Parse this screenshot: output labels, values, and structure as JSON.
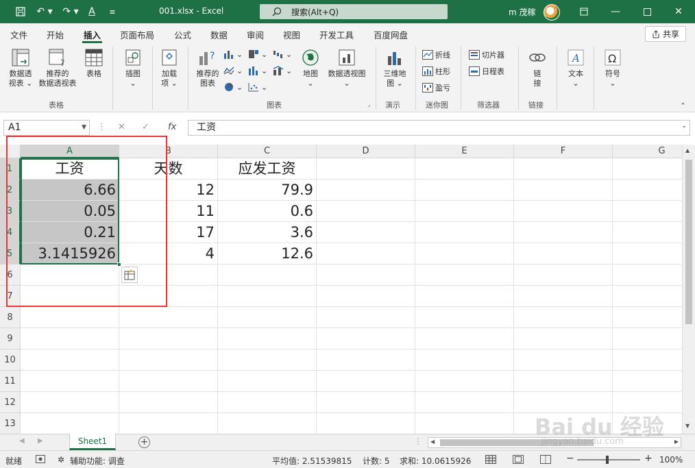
{
  "window": {
    "doc_title": "001.xlsx  -  Excel",
    "search_placeholder": "搜索(Alt+Q)",
    "user": "m 茂稼",
    "accent": "#1e7145"
  },
  "menu": {
    "tabs": [
      "文件",
      "开始",
      "插入",
      "页面布局",
      "公式",
      "数据",
      "审阅",
      "视图",
      "开发工具",
      "百度网盘"
    ],
    "active": "插入",
    "share": "共享"
  },
  "ribbon": {
    "pivot1": "数据透",
    "pivot2": "视表",
    "recpivot1": "推荐的",
    "recpivot2": "数据透视表",
    "table": "表格",
    "group_table": "表格",
    "illustration": "插图",
    "addin1": "加载",
    "addin2": "项",
    "recchart1": "推荐的",
    "recchart2": "图表",
    "map": "地图",
    "pivotchart": "数据透视图",
    "group_chart": "图表",
    "map3d1": "三维地",
    "map3d2": "图",
    "group_tour": "演示",
    "spark_line": "折线",
    "spark_column": "柱形",
    "spark_winloss": "盈亏",
    "group_spark": "迷你图",
    "slicer": "切片器",
    "timeline": "日程表",
    "group_filter": "筛选器",
    "link1": "链",
    "link2": "接",
    "group_link": "链接",
    "text": "文本",
    "symbol": "符号"
  },
  "formula": {
    "namebox": "A1",
    "content": "工资"
  },
  "grid": {
    "columns": [
      "A",
      "B",
      "C",
      "D",
      "E",
      "F",
      "G"
    ],
    "rows": [
      "1",
      "2",
      "3",
      "4",
      "5",
      "6",
      "7",
      "8",
      "9",
      "10",
      "11",
      "12",
      "13"
    ],
    "cells": {
      "A1": "工资",
      "B1": "天数",
      "C1": "应发工资",
      "A2": "6.66",
      "B2": "12",
      "C2": "79.9",
      "A3": "0.05",
      "B3": "11",
      "C3": "0.6",
      "A4": "0.21",
      "B4": "17",
      "C4": "3.6",
      "A5": "3.1415926",
      "B5": "4",
      "C5": "12.6"
    }
  },
  "sheets": {
    "tab": "Sheet1"
  },
  "status": {
    "ready": "就绪",
    "accessibility": "辅助功能: 调查",
    "average": "平均值: 2.51539815",
    "count": "计数: 5",
    "sum": "求和: 10.0615926",
    "zoom": "100%"
  },
  "watermark": {
    "main": "Bai du 经验",
    "sub": "jingyan.baidu.com"
  }
}
